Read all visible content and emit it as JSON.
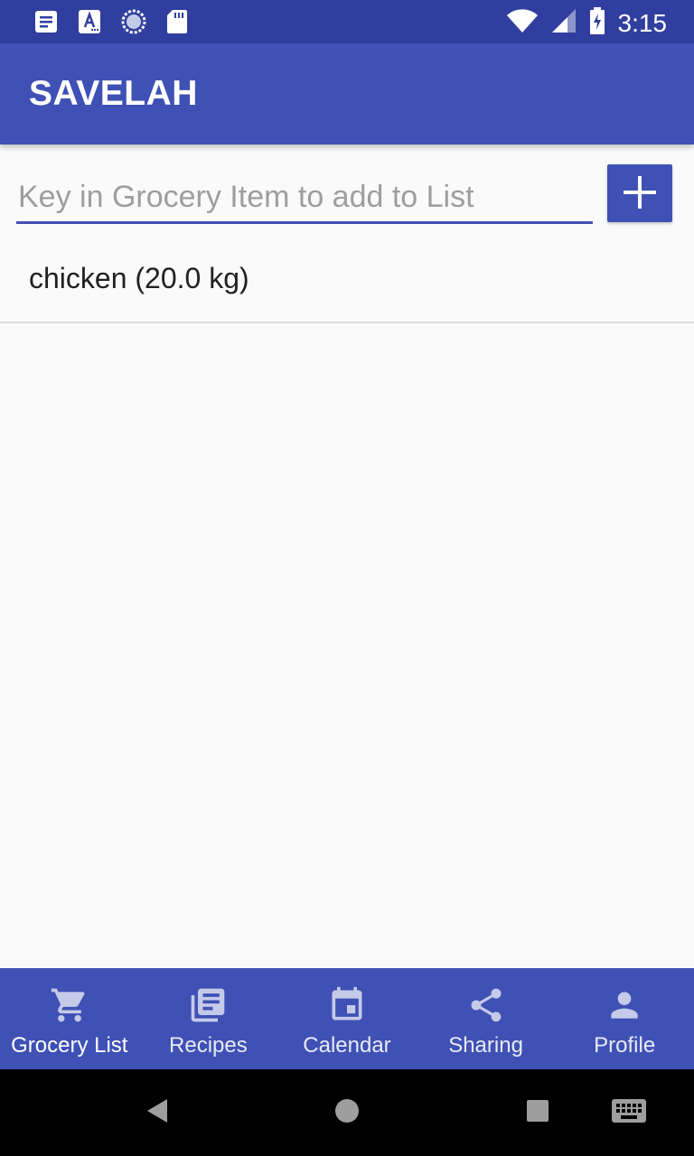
{
  "status_bar": {
    "time": "3:15",
    "icons_left": [
      "document-icon",
      "text-a-icon",
      "sync-spinner-icon",
      "sd-card-icon"
    ],
    "icons_right": [
      "wifi-icon",
      "signal-icon",
      "battery-charging-icon"
    ]
  },
  "app_bar": {
    "title": "SAVELAH"
  },
  "add_item": {
    "placeholder": "Key in Grocery Item to add to List",
    "value": "",
    "button_icon": "plus-icon"
  },
  "grocery_list": {
    "items": [
      {
        "label": "chicken (20.0 kg)"
      }
    ]
  },
  "bottom_nav": {
    "items": [
      {
        "label": "Grocery List",
        "icon": "cart-icon"
      },
      {
        "label": "Recipes",
        "icon": "recipes-icon"
      },
      {
        "label": "Calendar",
        "icon": "calendar-icon"
      },
      {
        "label": "Sharing",
        "icon": "share-icon"
      },
      {
        "label": "Profile",
        "icon": "person-icon"
      }
    ]
  },
  "colors": {
    "primary": "#3f51b5",
    "primary_dark": "#303f9f",
    "background": "#fafafa"
  }
}
